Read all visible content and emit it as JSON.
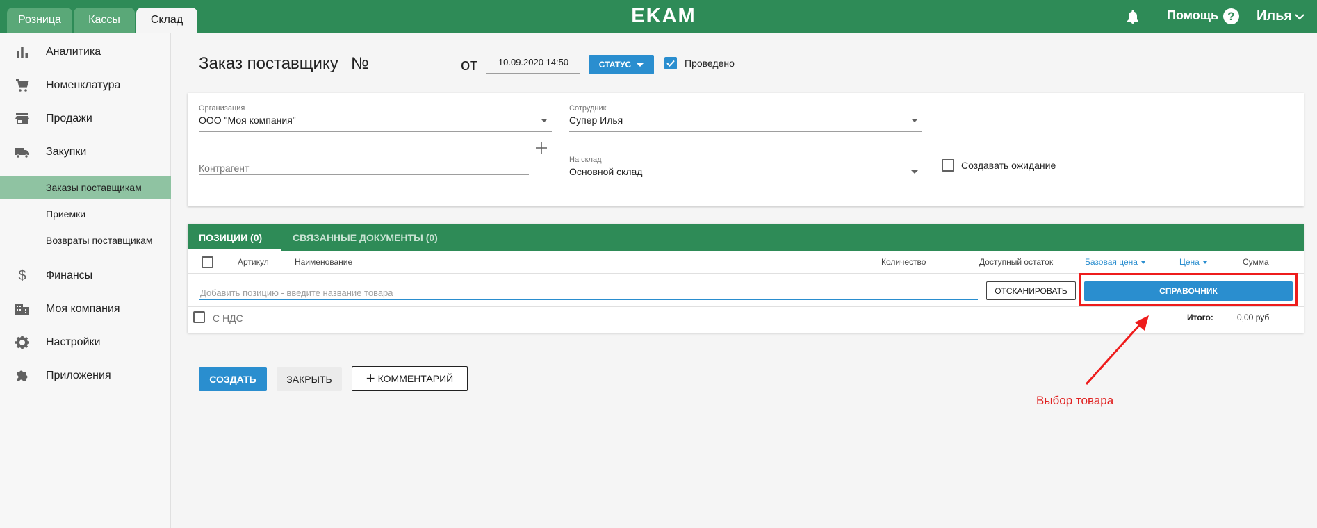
{
  "topbar": {
    "tabs": [
      "Розница",
      "Кассы",
      "Склад"
    ],
    "active_tab": "Склад",
    "logo": "EKAM",
    "help_label": "Помощь",
    "help_icon": "?",
    "user_label": "Илья",
    "color": "#2e8b57"
  },
  "sidebar": {
    "items": [
      {
        "label": "Аналитика",
        "icon": "bar-chart-icon"
      },
      {
        "label": "Номенклатура",
        "icon": "cart-icon"
      },
      {
        "label": "Продажи",
        "icon": "store-icon"
      },
      {
        "label": "Закупки",
        "icon": "truck-icon"
      }
    ],
    "sub_items": [
      "Заказы поставщикам",
      "Приемки",
      "Возвраты поставщикам"
    ],
    "active_sub": "Заказы поставщикам",
    "bottom_items": [
      {
        "label": "Финансы",
        "icon": "dollar-icon"
      },
      {
        "label": "Моя компания",
        "icon": "building-icon"
      },
      {
        "label": "Настройки",
        "icon": "gear-icon"
      },
      {
        "label": "Приложения",
        "icon": "puzzle-icon"
      }
    ]
  },
  "header": {
    "title": "Заказ поставщику",
    "number_label": "№",
    "number_value": "",
    "date_label": "от",
    "date_value": "10.09.2020 14:50",
    "status_button": "СТАТУС",
    "posted_label": "Проведено",
    "posted_checked": true
  },
  "form": {
    "organization_label": "Организация",
    "organization_value": "ООО \"Моя компания\"",
    "employee_label": "Сотрудник",
    "employee_value": "Супер Илья",
    "counterparty_placeholder": "Контрагент",
    "warehouse_label": "На склад",
    "warehouse_value": "Основной склад",
    "create_wait_label": "Создавать ожидание",
    "create_wait_checked": false
  },
  "positions": {
    "tabs": [
      "ПОЗИЦИИ (0)",
      "СВЯЗАННЫЕ ДОКУМЕНТЫ (0)"
    ],
    "active_tab": "ПОЗИЦИИ (0)",
    "columns": [
      "Артикул",
      "Наименование",
      "Количество",
      "Доступный остаток",
      "Базовая цена",
      "Цена",
      "Сумма"
    ],
    "add_placeholder": "Добавить позицию - введите название товара",
    "scan_button": "ОТСКАНИРОВАТЬ",
    "reference_button": "СПРАВОЧНИК",
    "vat_label": "С НДС",
    "vat_checked": false,
    "total_label": "Итого:",
    "total_value": "0,00 руб"
  },
  "actions": {
    "create": "СОЗДАТЬ",
    "close": "ЗАКРЫТЬ",
    "comment": "КОММЕНТАРИЙ"
  },
  "annotation": {
    "text": "Выбор товара",
    "color": "#e0201f"
  }
}
